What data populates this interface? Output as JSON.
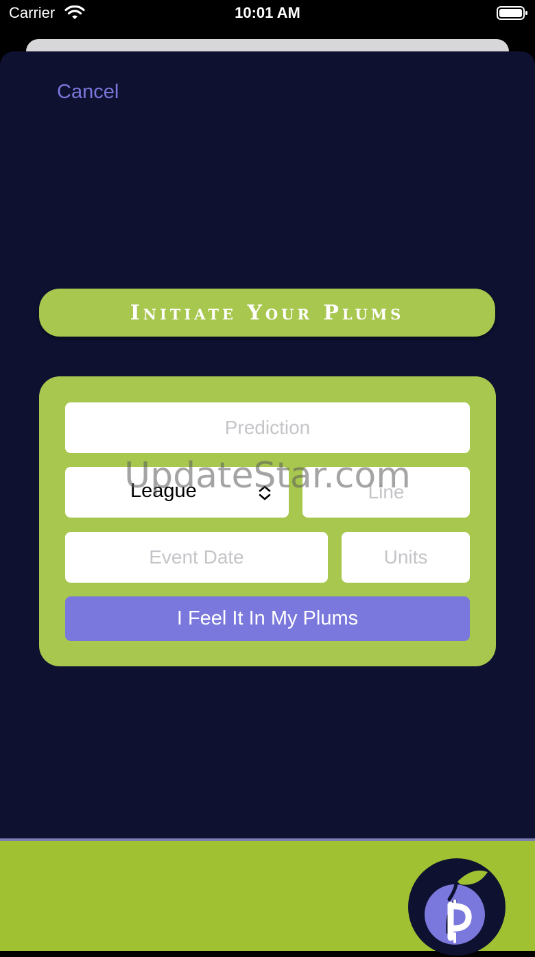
{
  "status_bar": {
    "carrier": "Carrier",
    "time": "10:01 AM"
  },
  "header": {
    "cancel_label": "Cancel"
  },
  "banner": {
    "title": "Initiate Your Plums"
  },
  "form": {
    "prediction_placeholder": "Prediction",
    "league_value": "League",
    "line_placeholder": "Line",
    "event_date_placeholder": "Event Date",
    "units_placeholder": "Units",
    "submit_label": "I Feel It In My Plums"
  },
  "watermark": {
    "text": "UpdateStar.com"
  },
  "colors": {
    "background": "#0e1130",
    "accent_green": "#a8c74f",
    "footer_green": "#a0c232",
    "button_purple": "#7a78dc",
    "cancel_purple": "#7b78dc"
  },
  "icons": {
    "wifi": "wifi-icon",
    "battery": "battery-icon",
    "select_chevron": "chevron-updown-icon",
    "logo": "plum-logo"
  }
}
